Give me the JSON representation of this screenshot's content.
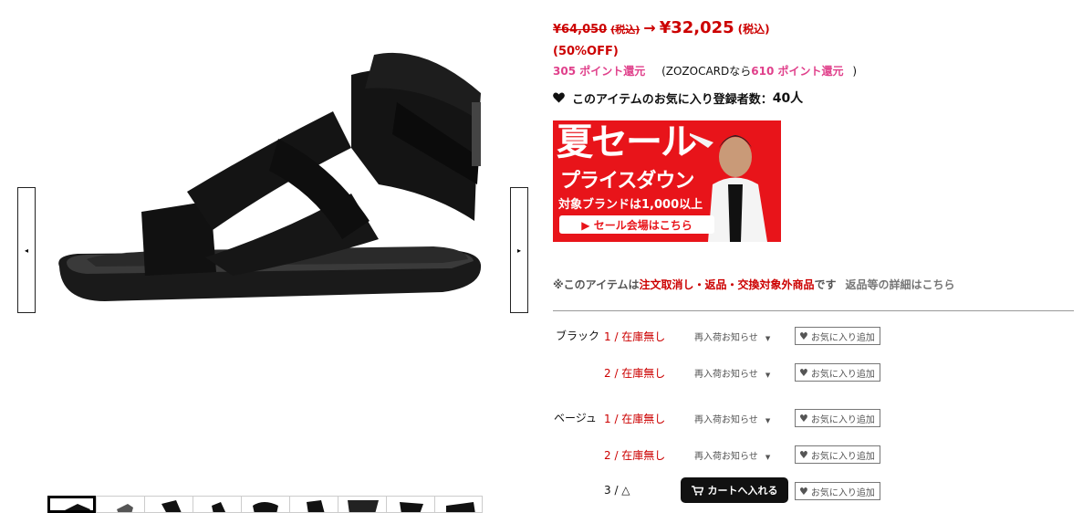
{
  "gallery": {
    "prev_icon": "◂",
    "next_icon": "▸",
    "thumb_count": 9
  },
  "price": {
    "original": "¥64,050",
    "original_tax": "(税込)",
    "arrow": "→",
    "sale": "¥32,025",
    "sale_tax": "(税込)",
    "discount": "(50%OFF)"
  },
  "points": {
    "value": "305 ポイント還元",
    "card_prefix": "(ZOZOCARDなら",
    "card_value": "610 ポイント還元",
    "card_suffix": ")"
  },
  "favorites": {
    "icon": "heart-icon",
    "label": "このアイテムのお気に入り登録者数：",
    "count": "40人"
  },
  "banner": {
    "title": "夏セール",
    "subtitle": "プライスダウン",
    "brands": "対象ブランドは1,000以上",
    "cta": "▶ セール会場はこちら"
  },
  "notice": {
    "prefix": "※このアイテムは",
    "emphasis": "注文取消し・返品・交換対象外商品",
    "suffix": "です",
    "link": "返品等の詳細はこちら"
  },
  "stock": {
    "restock_label": "再入荷お知らせ",
    "restock_icon": "▼",
    "fav_label": "お気に入り追加",
    "cart_label": "カートへ入れる",
    "colors": [
      {
        "name": "ブラック",
        "sizes": [
          {
            "size": "1 / 在庫無し"
          },
          {
            "size": "2 / 在庫無し"
          }
        ]
      },
      {
        "name": "ベージュ",
        "sizes": [
          {
            "size": "1 / 在庫無し"
          },
          {
            "size": "2 / 在庫無し"
          },
          {
            "size": "3 / △"
          }
        ]
      }
    ]
  },
  "colors": {
    "accent_red": "#cc0000",
    "point_pink": "#e0408b",
    "banner_red": "#e8141a"
  }
}
